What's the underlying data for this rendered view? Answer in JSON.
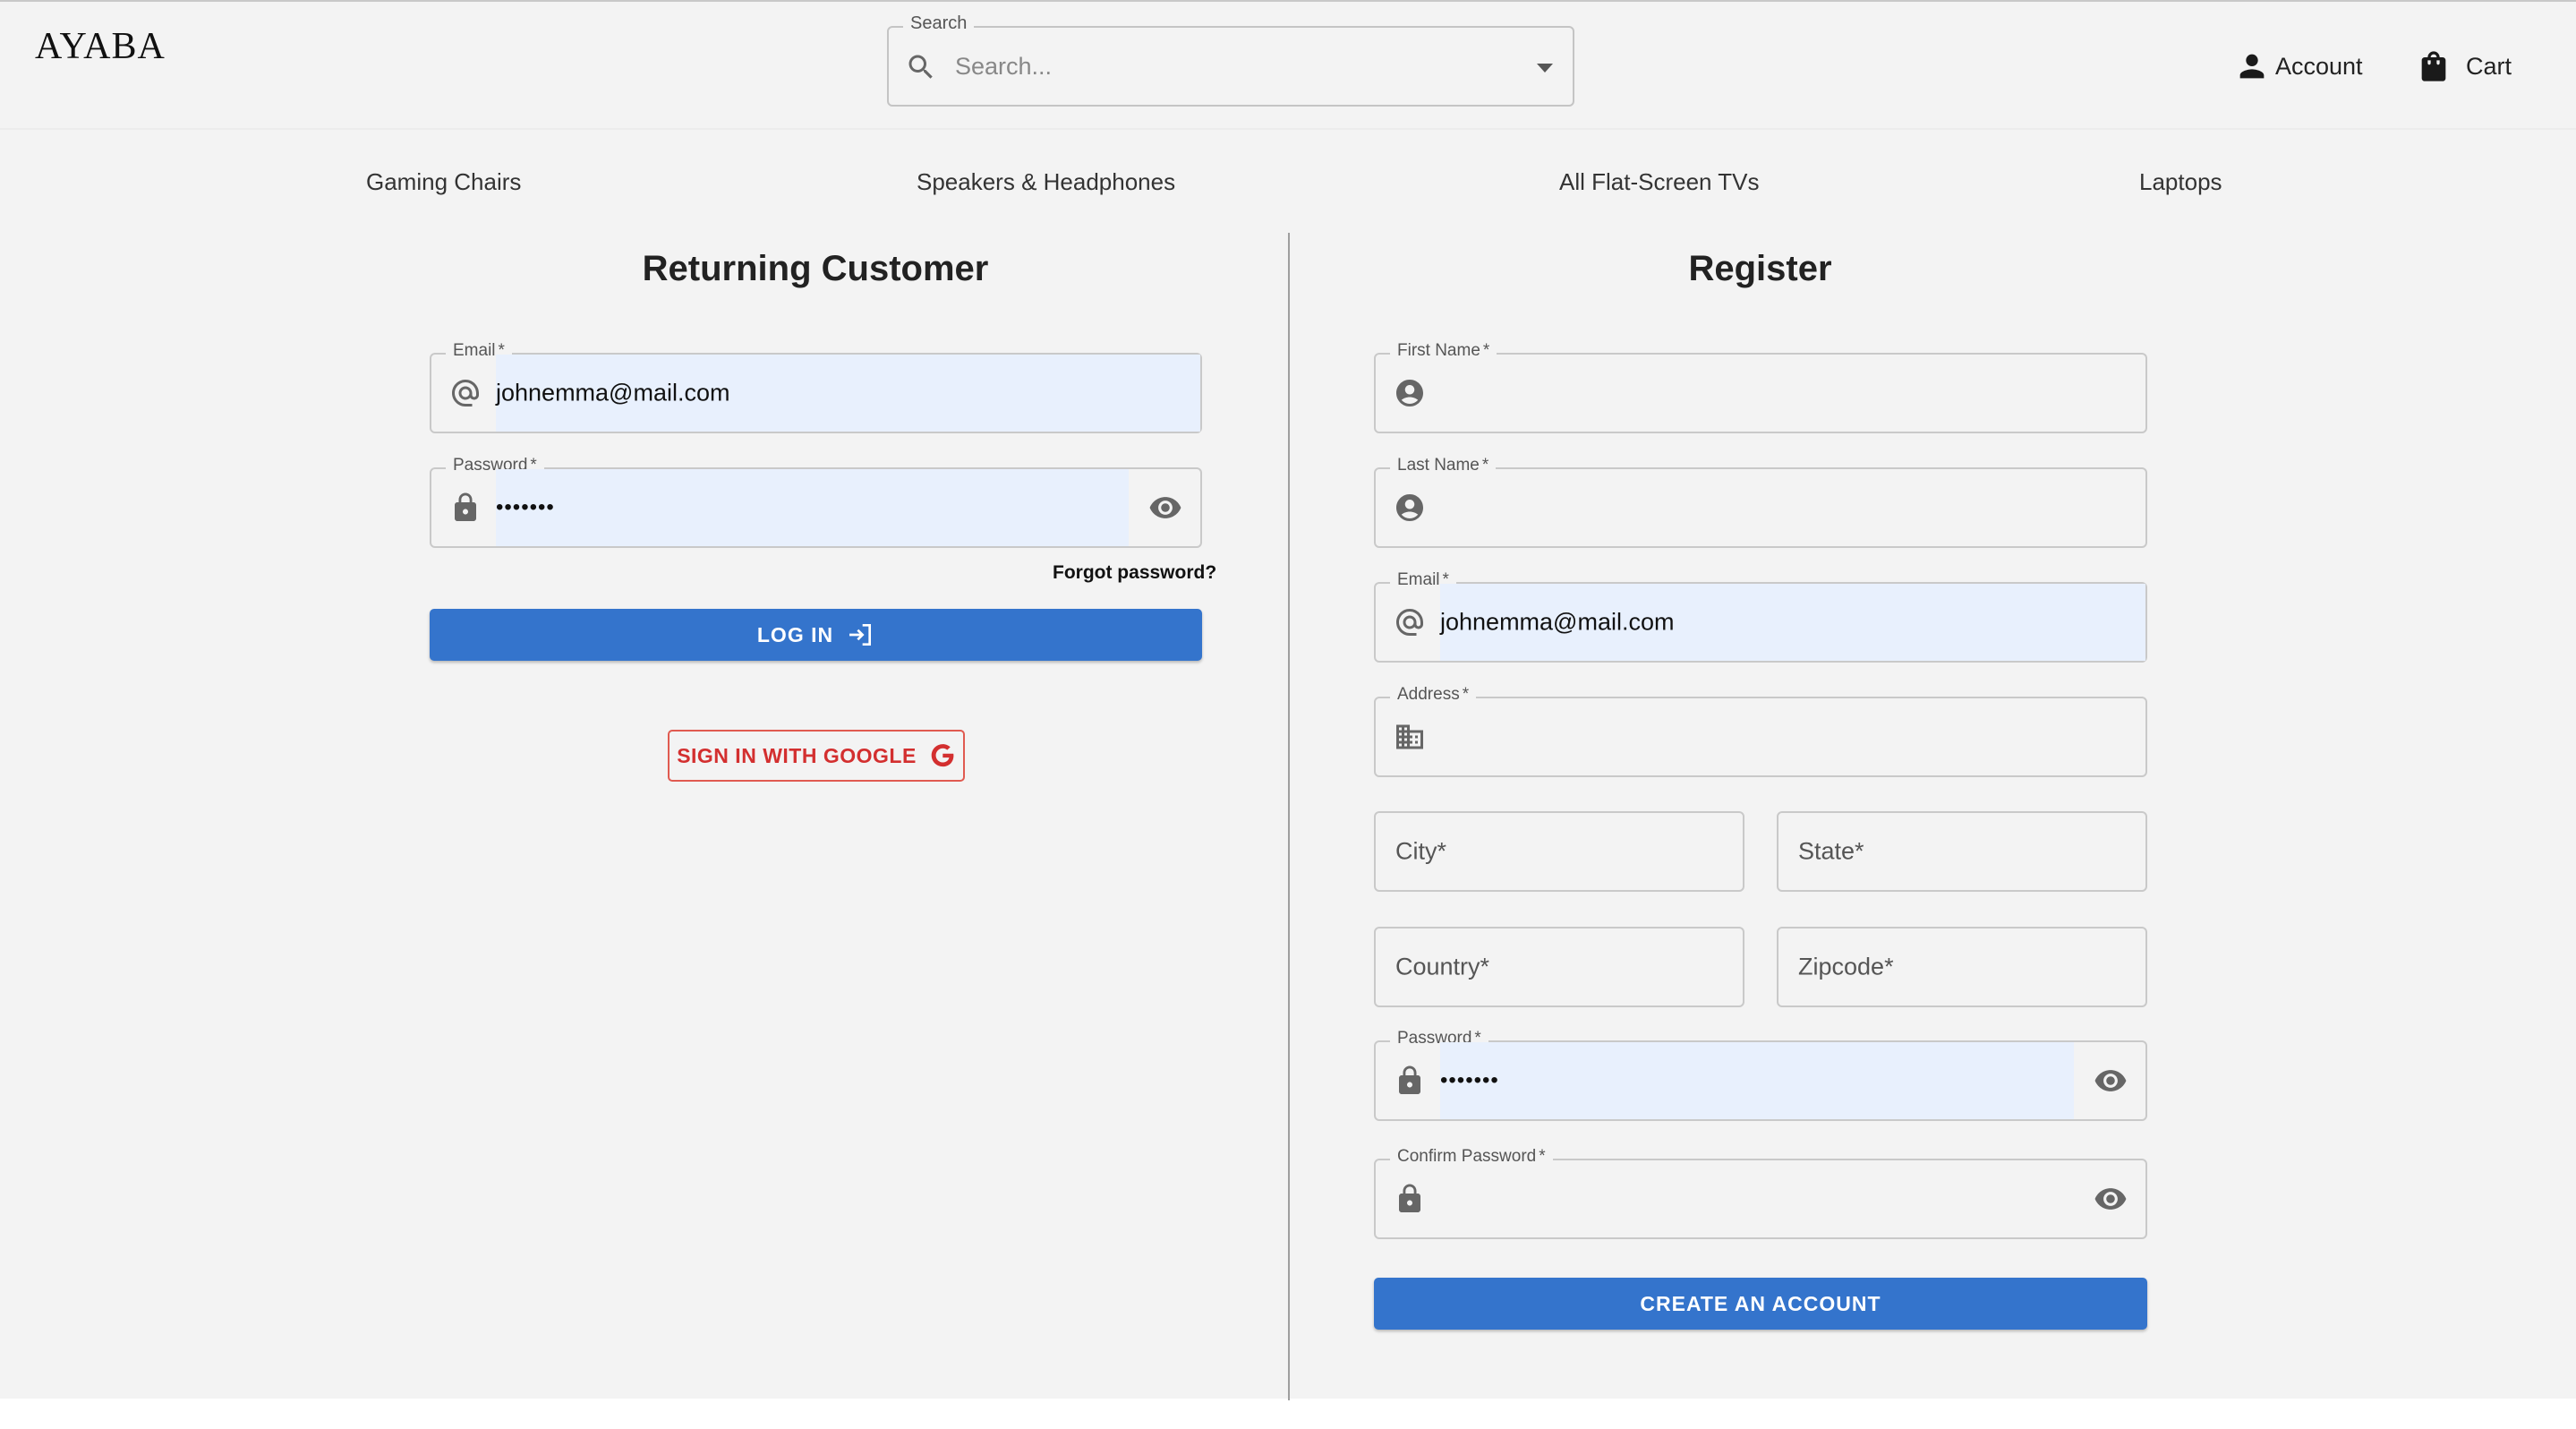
{
  "header": {
    "logo": "AYABA",
    "search": {
      "legend": "Search",
      "placeholder": "Search..."
    },
    "account_label": "Account",
    "cart_label": "Cart"
  },
  "nav": {
    "items": [
      {
        "label": "Gaming Chairs"
      },
      {
        "label": "Speakers & Headphones"
      },
      {
        "label": "All Flat-Screen TVs"
      },
      {
        "label": "Laptops"
      }
    ]
  },
  "login": {
    "title": "Returning Customer",
    "email_label": "Email",
    "email_value": "johnemma@mail.com",
    "password_label": "Password",
    "password_value": "•••••••",
    "forgot_label": "Forgot password?",
    "login_button": "LOG IN",
    "google_button": "SIGN IN WITH GOOGLE"
  },
  "register": {
    "title": "Register",
    "first_name_label": "First Name",
    "last_name_label": "Last Name",
    "email_label": "Email",
    "email_value": "johnemma@mail.com",
    "address_label": "Address",
    "city_label": "City",
    "state_label": "State",
    "country_label": "Country",
    "zipcode_label": "Zipcode",
    "password_label": "Password",
    "password_value": "•••••••",
    "confirm_password_label": "Confirm Password",
    "create_button": "CREATE AN ACCOUNT"
  },
  "common": {
    "required_mark": "*"
  },
  "colors": {
    "primary": "#3474cc",
    "google_red": "#d32f2f",
    "autofill_bg": "#e8f0fd",
    "page_bg": "#f3f3f3"
  }
}
